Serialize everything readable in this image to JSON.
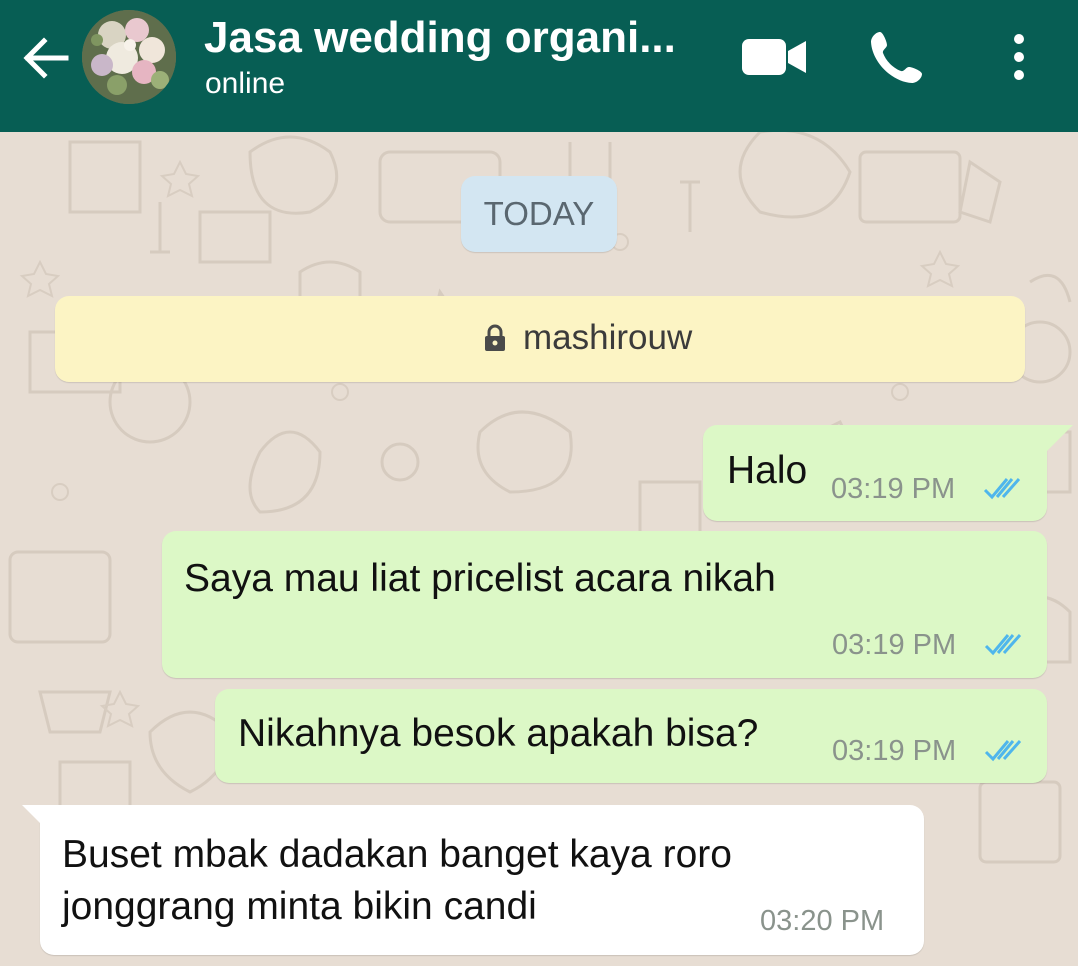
{
  "header": {
    "contact_name": "Jasa wedding organi...",
    "status": "online",
    "back_icon": "arrow-left-icon",
    "video_icon": "video-camera-icon",
    "call_icon": "phone-icon",
    "menu_icon": "more-vertical-icon",
    "background_color": "#075e54"
  },
  "chat": {
    "date_label": "TODAY",
    "system_note": "mashirouw",
    "system_note_icon": "lock-icon",
    "messages": [
      {
        "direction": "outgoing",
        "text": "Halo",
        "time": "03:19 PM",
        "status": "read"
      },
      {
        "direction": "outgoing",
        "text": "Saya mau liat pricelist acara nikah",
        "time": "03:19 PM",
        "status": "read"
      },
      {
        "direction": "outgoing",
        "text": "Nikahnya besok apakah bisa?",
        "time": "03:19 PM",
        "status": "read"
      },
      {
        "direction": "incoming",
        "lines": [
          "Buset mbak dadakan banget kaya roro",
          "jonggrang minta bikin candi"
        ],
        "time": "03:20 PM"
      }
    ],
    "colors": {
      "outgoing_bubble": "#dcf8c6",
      "incoming_bubble": "#ffffff",
      "read_tick": "#4fb6ec",
      "date_chip": "#d3e6f2",
      "system_note_bg": "#fcf4c4"
    }
  }
}
